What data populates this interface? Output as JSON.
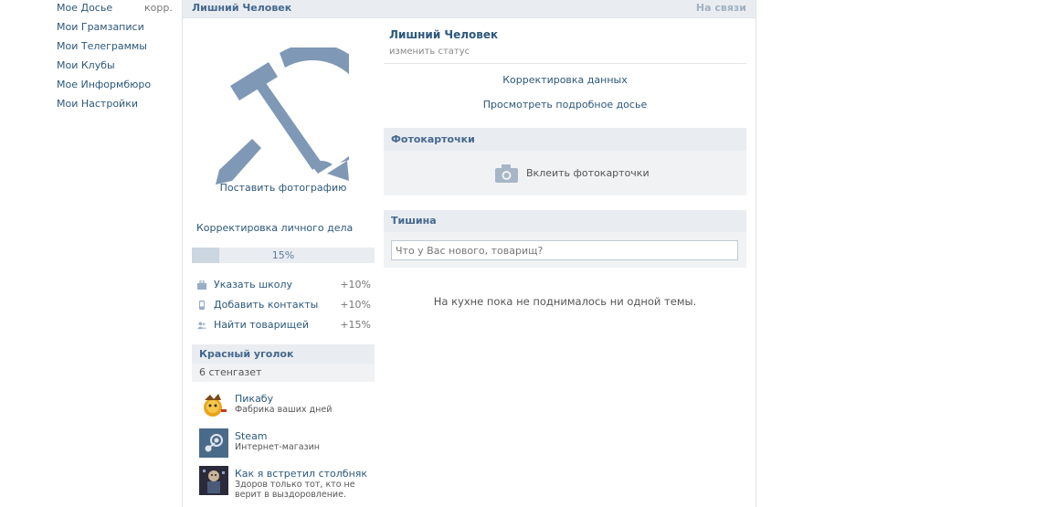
{
  "left_nav": {
    "items": [
      {
        "label": "Мое Досье"
      },
      {
        "label": "Мои Грамзаписи"
      },
      {
        "label": "Мои Телеграммы"
      },
      {
        "label": "Мои Клубы"
      },
      {
        "label": "Мое Информбюро"
      },
      {
        "label": "Мои Настройки"
      }
    ],
    "extra": "корр."
  },
  "topbar": {
    "name": "Лишний Человек",
    "status": "На связи"
  },
  "profile": {
    "avatar_caption": "Поставить фотографию",
    "edit_link": "Корректировка личного дела",
    "progress_label": "15%",
    "progress_fraction": 0.15,
    "tips": [
      {
        "icon": "briefcase-icon",
        "label": "Указать школу",
        "pct": "+10%"
      },
      {
        "icon": "phone-icon",
        "label": "Добавить контакты",
        "pct": "+10%"
      },
      {
        "icon": "users-icon",
        "label": "Найти товарищей",
        "pct": "+15%"
      }
    ]
  },
  "red_corner": {
    "title": "Красный уголок",
    "count": "6 стенгазет",
    "groups": [
      {
        "name": "Пикабу",
        "desc": "Фабрика ваших дней"
      },
      {
        "name": "Steam",
        "desc": "Интернет-магазин"
      },
      {
        "name": "Как я встретил столбняк",
        "desc": "Здоров только тот, кто не верит в выздоровление."
      }
    ]
  },
  "main": {
    "name": "Лишний Человек",
    "status_link": "изменить статус",
    "edit_data": "Корректировка данных",
    "view_dossier": "Просмотреть подробное досье",
    "photos_title": "Фотокарточки",
    "photos_enable": "Вклеить фотокарточки",
    "wall_title": "Тишина",
    "wall_placeholder": "Что у Вас нового, товарищ?",
    "wall_empty": "На кухне пока не поднималось ни одной темы."
  },
  "colors": {
    "link": "#2b587a",
    "header_bg": "#e9edf1",
    "avatar": "#7f98b5"
  }
}
